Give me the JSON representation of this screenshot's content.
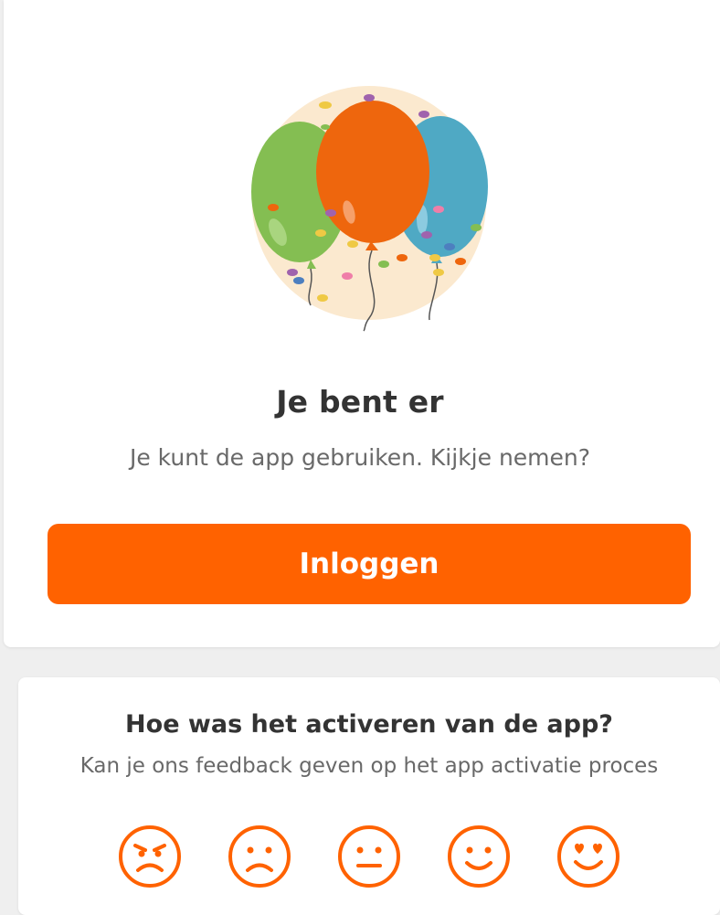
{
  "success": {
    "title": "Je bent er",
    "subtitle": "Je kunt de app gebruiken. Kijkje nemen?",
    "login_label": "Inloggen",
    "illustration": "balloons-confetti"
  },
  "feedback": {
    "title": "Hoe was het activeren van de app?",
    "subtitle": "Kan je ons feedback geven op het app activatie proces",
    "ratings": [
      "angry-face-icon",
      "sad-face-icon",
      "neutral-face-icon",
      "happy-face-icon",
      "love-face-icon"
    ]
  },
  "colors": {
    "accent": "#ff6200",
    "balloon_green": "#84be52",
    "balloon_orange": "#ee660d",
    "balloon_blue": "#4fa9c4",
    "background_circle": "#fbead0"
  }
}
